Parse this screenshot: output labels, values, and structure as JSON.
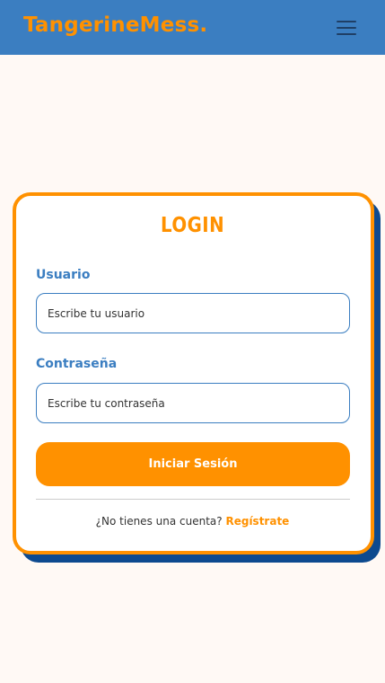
{
  "header": {
    "brand": "TangerineMess.",
    "menu_icon": "hamburger-menu-icon"
  },
  "login": {
    "title": "LOGIN",
    "username_label": "Usuario",
    "username_placeholder": "Escribe tu usuario",
    "password_label": "Contraseña",
    "password_placeholder": "Escribe tu contraseña",
    "submit_label": "Iniciar Sesión",
    "no_account_text": "¿No tienes una cuenta?",
    "register_link": "Regístrate"
  },
  "colors": {
    "header_bg": "#3b7ec1",
    "accent": "#ff9100",
    "card_shadow": "#0d4a8f",
    "page_bg": "#fff9f5"
  }
}
